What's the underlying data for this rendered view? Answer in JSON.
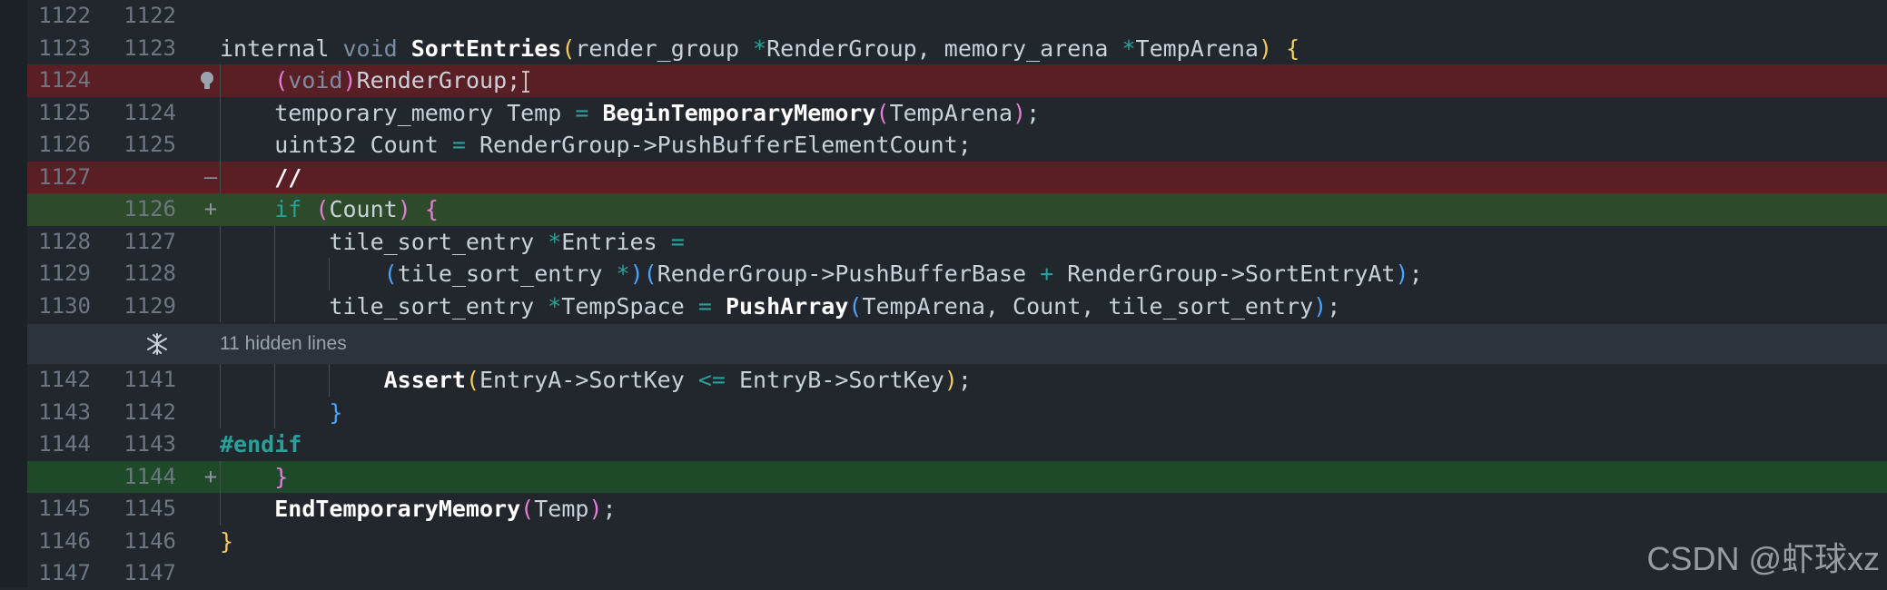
{
  "hidden_lines_label": "11 hidden lines",
  "watermark": "CSDN @虾球xz",
  "lines": [
    {
      "old": "1122",
      "new": "1122",
      "marker": "",
      "tokens": []
    },
    {
      "old": "1123",
      "new": "1123",
      "marker": "",
      "tokens": [
        {
          "t": "internal ",
          "c": "plain"
        },
        {
          "t": "void ",
          "c": "ty"
        },
        {
          "t": "SortEntries",
          "c": "fn"
        },
        {
          "t": "(",
          "c": "yb"
        },
        {
          "t": "render_group ",
          "c": "plain"
        },
        {
          "t": "*",
          "c": "op"
        },
        {
          "t": "RenderGroup, memory_arena ",
          "c": "plain"
        },
        {
          "t": "*",
          "c": "op"
        },
        {
          "t": "TempArena",
          "c": "plain"
        },
        {
          "t": ") {",
          "c": "yb"
        }
      ]
    },
    {
      "old": "1124",
      "new": "",
      "marker": "",
      "status": "deleted",
      "tokens": [
        {
          "t": "    ",
          "c": "plain"
        },
        {
          "t": "(",
          "c": "pn"
        },
        {
          "t": "void",
          "c": "ty"
        },
        {
          "t": ")",
          "c": "pn"
        },
        {
          "t": "RenderGroup;",
          "c": "plain"
        }
      ]
    },
    {
      "old": "1125",
      "new": "1124",
      "marker": "",
      "tokens": [
        {
          "t": "    temporary_memory Temp ",
          "c": "plain"
        },
        {
          "t": "=",
          "c": "op"
        },
        {
          "t": " ",
          "c": "plain"
        },
        {
          "t": "BeginTemporaryMemory",
          "c": "fn"
        },
        {
          "t": "(",
          "c": "pn"
        },
        {
          "t": "TempArena",
          "c": "plain"
        },
        {
          "t": ")",
          "c": "pn"
        },
        {
          "t": ";",
          "c": "plain"
        }
      ]
    },
    {
      "old": "1126",
      "new": "1125",
      "marker": "",
      "tokens": [
        {
          "t": "    uint32 Count ",
          "c": "plain"
        },
        {
          "t": "=",
          "c": "op"
        },
        {
          "t": " RenderGroup->PushBufferElementCount;",
          "c": "plain"
        }
      ]
    },
    {
      "old": "1127",
      "new": "",
      "marker": "—",
      "status": "deleted",
      "tokens": [
        {
          "t": "    ",
          "c": "plain"
        },
        {
          "t": "//",
          "c": "cmt"
        }
      ]
    },
    {
      "old": "",
      "new": "1126",
      "marker": "+",
      "status": "added-soft",
      "tokens": [
        {
          "t": "    ",
          "c": "plain"
        },
        {
          "t": "if",
          "c": "kw"
        },
        {
          "t": " ",
          "c": "plain"
        },
        {
          "t": "(",
          "c": "pn"
        },
        {
          "t": "Count",
          "c": "plain"
        },
        {
          "t": ")",
          "c": "pn"
        },
        {
          "t": " ",
          "c": "plain"
        },
        {
          "t": "{",
          "c": "pn"
        }
      ]
    },
    {
      "old": "1128",
      "new": "1127",
      "marker": "",
      "tokens": [
        {
          "t": "        tile_sort_entry ",
          "c": "plain"
        },
        {
          "t": "*",
          "c": "op"
        },
        {
          "t": "Entries ",
          "c": "plain"
        },
        {
          "t": "=",
          "c": "op"
        }
      ]
    },
    {
      "old": "1129",
      "new": "1128",
      "marker": "",
      "tokens": [
        {
          "t": "            ",
          "c": "plain"
        },
        {
          "t": "(",
          "c": "bb"
        },
        {
          "t": "tile_sort_entry ",
          "c": "plain"
        },
        {
          "t": "*",
          "c": "op"
        },
        {
          "t": ")",
          "c": "bb"
        },
        {
          "t": "(",
          "c": "bb"
        },
        {
          "t": "RenderGroup->PushBufferBase ",
          "c": "plain"
        },
        {
          "t": "+",
          "c": "op"
        },
        {
          "t": " RenderGroup->SortEntryAt",
          "c": "plain"
        },
        {
          "t": ")",
          "c": "bb"
        },
        {
          "t": ";",
          "c": "plain"
        }
      ]
    },
    {
      "old": "1130",
      "new": "1129",
      "marker": "",
      "tokens": [
        {
          "t": "        tile_sort_entry ",
          "c": "plain"
        },
        {
          "t": "*",
          "c": "op"
        },
        {
          "t": "TempSpace ",
          "c": "plain"
        },
        {
          "t": "=",
          "c": "op"
        },
        {
          "t": " ",
          "c": "plain"
        },
        {
          "t": "PushArray",
          "c": "fn"
        },
        {
          "t": "(",
          "c": "bb"
        },
        {
          "t": "TempArena, Count, tile_sort_entry",
          "c": "plain"
        },
        {
          "t": ")",
          "c": "bb"
        },
        {
          "t": ";",
          "c": "plain"
        }
      ]
    }
  ],
  "lines_after": [
    {
      "old": "1142",
      "new": "1141",
      "marker": "",
      "tokens": [
        {
          "t": "            ",
          "c": "plain"
        },
        {
          "t": "Assert",
          "c": "fn"
        },
        {
          "t": "(",
          "c": "yb"
        },
        {
          "t": "EntryA->SortKey ",
          "c": "plain"
        },
        {
          "t": "<=",
          "c": "op"
        },
        {
          "t": " EntryB->SortKey",
          "c": "plain"
        },
        {
          "t": ")",
          "c": "yb"
        },
        {
          "t": ";",
          "c": "plain"
        }
      ]
    },
    {
      "old": "1143",
      "new": "1142",
      "marker": "",
      "tokens": [
        {
          "t": "        ",
          "c": "plain"
        },
        {
          "t": "}",
          "c": "bb"
        }
      ]
    },
    {
      "old": "1144",
      "new": "1143",
      "marker": "",
      "tokens": [
        {
          "t": "#endif",
          "c": "pp"
        }
      ]
    },
    {
      "old": "",
      "new": "1144",
      "marker": "+",
      "status": "added",
      "tokens": [
        {
          "t": "    ",
          "c": "plain"
        },
        {
          "t": "}",
          "c": "pn"
        }
      ]
    },
    {
      "old": "1145",
      "new": "1145",
      "marker": "",
      "tokens": [
        {
          "t": "    ",
          "c": "plain"
        },
        {
          "t": "EndTemporaryMemory",
          "c": "fn"
        },
        {
          "t": "(",
          "c": "pn"
        },
        {
          "t": "Temp",
          "c": "plain"
        },
        {
          "t": ")",
          "c": "pn"
        },
        {
          "t": ";",
          "c": "plain"
        }
      ]
    },
    {
      "old": "1146",
      "new": "1146",
      "marker": "",
      "tokens": [
        {
          "t": "}",
          "c": "yb"
        }
      ]
    },
    {
      "old": "1147",
      "new": "1147",
      "marker": "",
      "tokens": []
    }
  ]
}
